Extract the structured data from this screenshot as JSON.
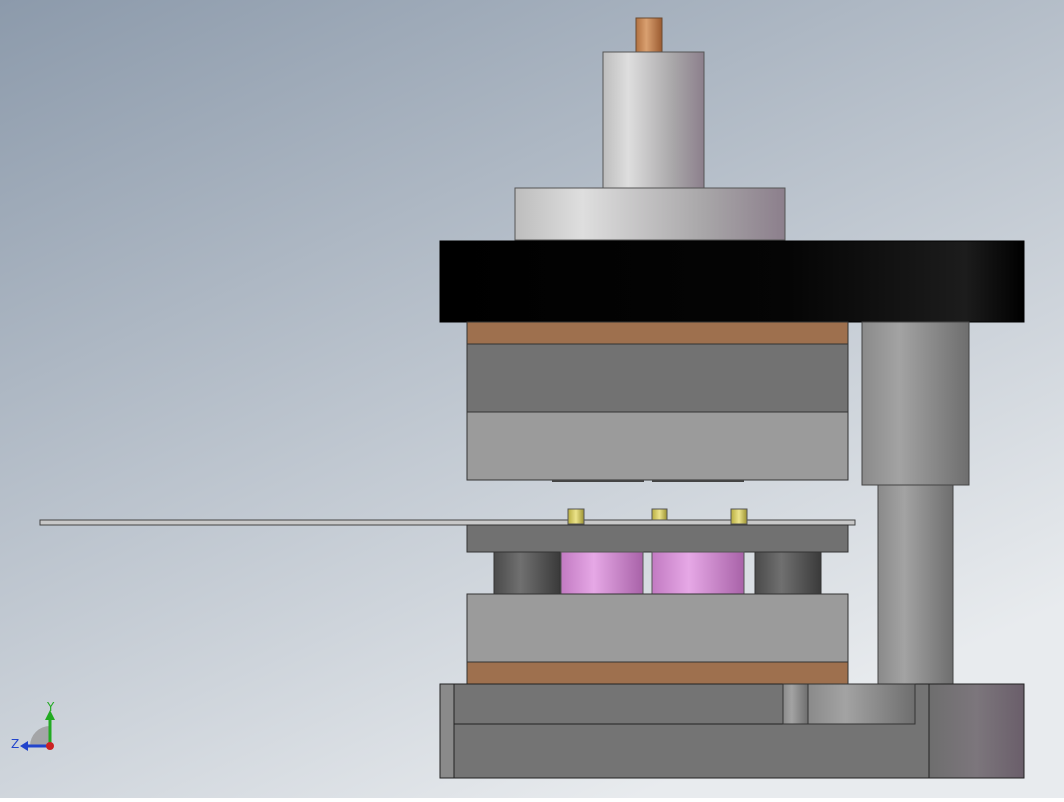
{
  "viewport": {
    "background_top": "#8f9cab",
    "background_bottom": "#e6e9ec"
  },
  "parts": {
    "punch_tip_color": "#c98a5a",
    "top_plate_color": "#050505",
    "copper_plate_color": "#9c6e4c",
    "dark_plate_color": "#727272",
    "light_plate_color": "#9a9a9a",
    "pilot_pin_color": "#d7cf6a",
    "spring_color": "#d69ad6",
    "guide_post_color": "#8f8f8f"
  },
  "triad": {
    "y_label": "Y",
    "z_label": "Z",
    "y_color": "#22aa22",
    "z_color": "#2244cc",
    "x_color": "#cc2222"
  }
}
